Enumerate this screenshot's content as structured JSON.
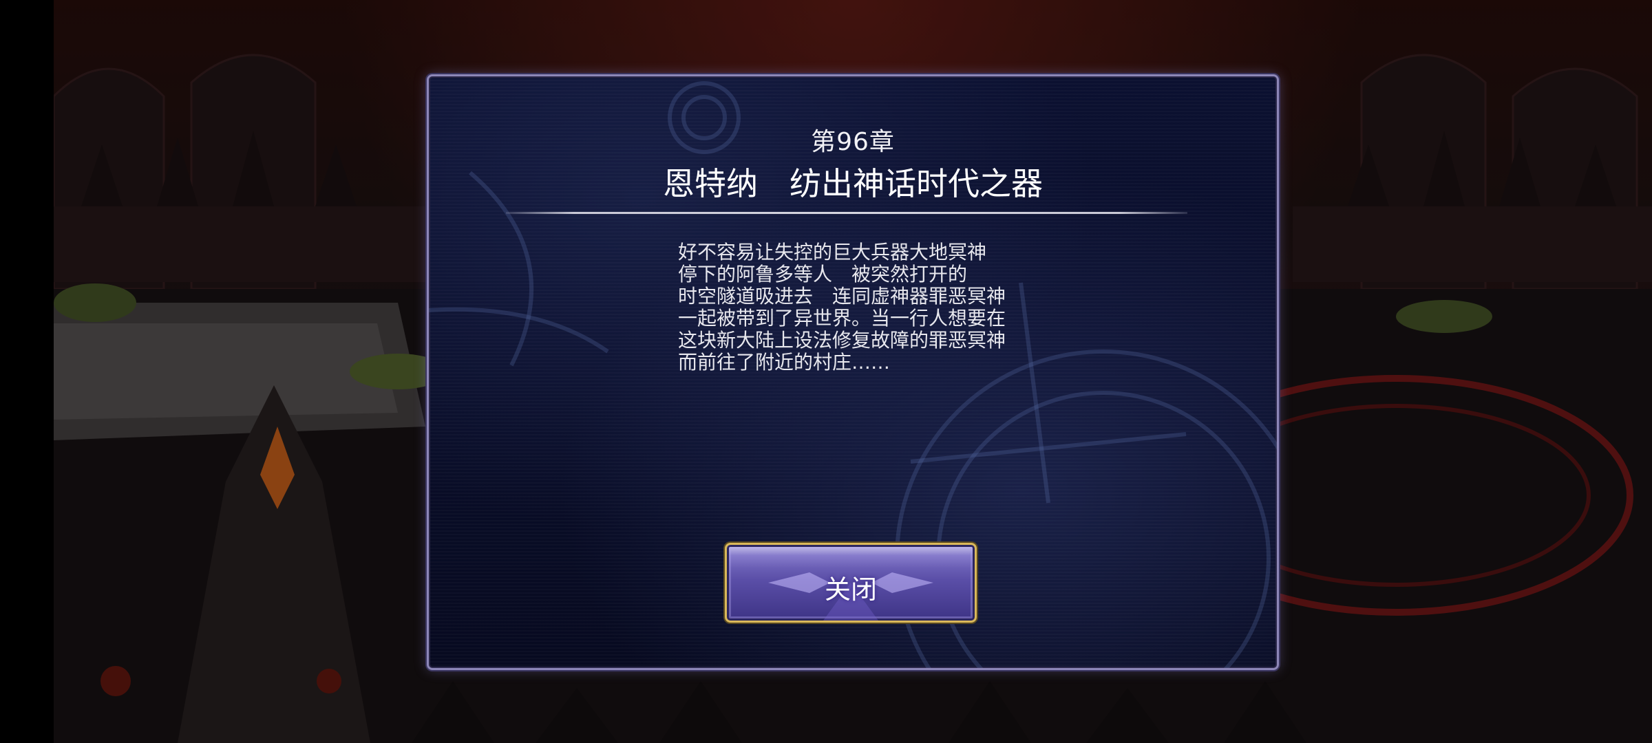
{
  "dialog": {
    "chapter_number": "第96章",
    "chapter_title": "恩特纳　纺出神话时代之器",
    "story_lines": [
      "好不容易让失控的巨大兵器大地冥神",
      "停下的阿鲁多等人　被突然打开的",
      "时空隧道吸进去　连同虚神器罪恶冥神",
      "一起被带到了异世界。当一行人想要在",
      "这块新大陆上设法修复故障的罪恶冥神",
      "而前往了附近的村庄……"
    ],
    "close_label": "关闭"
  },
  "colors": {
    "dialog_border": "#8d87b8",
    "dialog_background": "#0a0e2a",
    "button_gold": "#d9b85a",
    "button_purple": "#5b4fa8"
  }
}
